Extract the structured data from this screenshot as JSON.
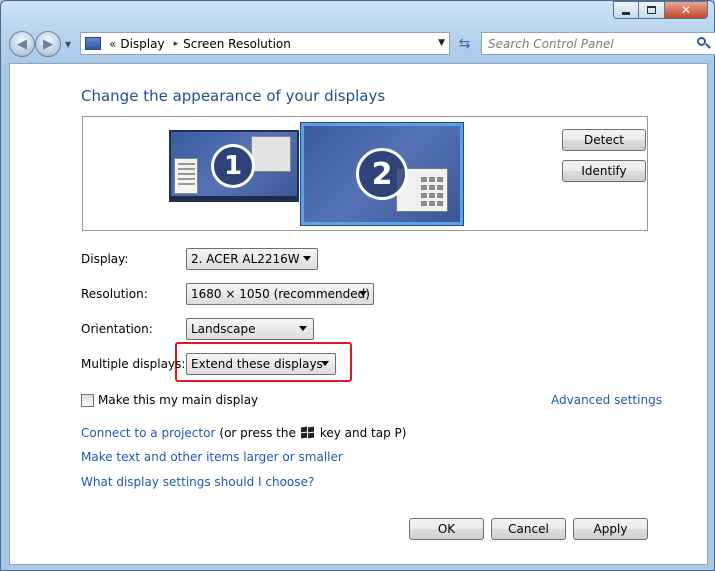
{
  "window": {
    "minimize_icon": "minimize-icon",
    "maximize_icon": "maximize-icon",
    "close_icon": "close-icon"
  },
  "nav": {
    "breadcrumb_prefix": "«",
    "breadcrumb": [
      "Display",
      "Screen Resolution"
    ],
    "breadcrumb_separator": "▸",
    "search_placeholder": "Search Control Panel"
  },
  "main": {
    "title": "Change the appearance of your displays",
    "monitors": [
      {
        "number": "1",
        "selected": false
      },
      {
        "number": "2",
        "selected": true
      }
    ],
    "detect_label": "Detect",
    "identify_label": "Identify",
    "fields": {
      "display": {
        "label": "Display:",
        "value": "2. ACER AL2216W"
      },
      "resolution": {
        "label": "Resolution:",
        "value": "1680 × 1050 (recommended)"
      },
      "orientation": {
        "label": "Orientation:",
        "value": "Landscape"
      },
      "multiple": {
        "label": "Multiple displays:",
        "value": "Extend these displays"
      }
    },
    "main_display_label": "Make this my main display",
    "main_display_checked": false,
    "advanced_settings": "Advanced settings",
    "projector_link": "Connect to a projector",
    "projector_suffix_before": "(or press the",
    "projector_suffix_after": "key and tap P)",
    "text_size_link": "Make text and other items larger or smaller",
    "help_link": "What display settings should I choose?",
    "ok_label": "OK",
    "cancel_label": "Cancel",
    "apply_label": "Apply"
  },
  "colors": {
    "title_blue": "#1e4f91",
    "link_blue": "#1e59b3",
    "highlight_red": "#e0191f"
  }
}
